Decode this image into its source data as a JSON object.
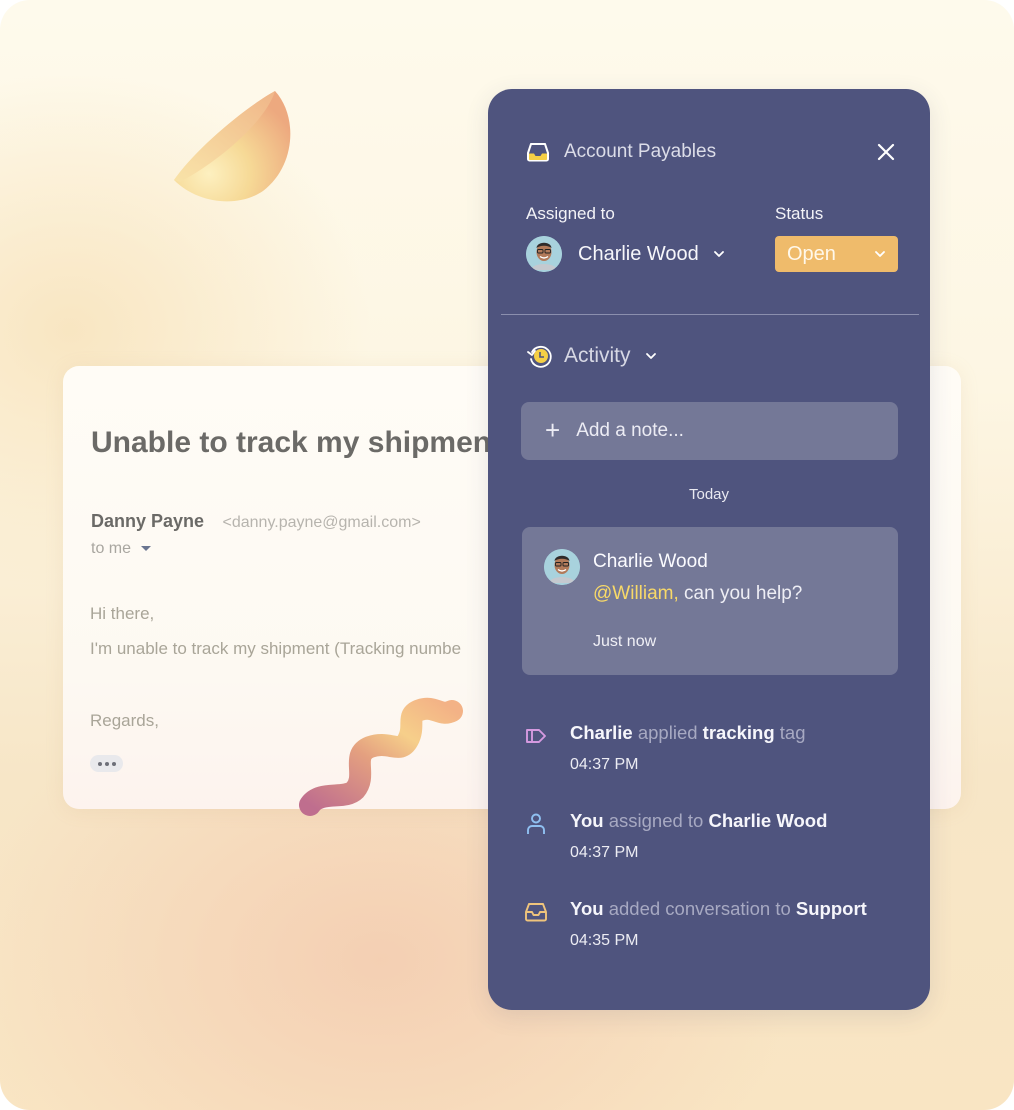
{
  "email": {
    "subject": "Unable to track my shipment",
    "sender_name": "Danny Payne",
    "sender_email": "<danny.payne@gmail.com>",
    "recipient": "to me",
    "body": [
      "Hi there,",
      "I'm unable to track my shipment (Tracking numbe"
    ],
    "signoff": "Regards,",
    "more_icon": "ellipsis-icon"
  },
  "panel": {
    "title": "Account Payables",
    "title_icon": "inbox-icon",
    "close_icon": "close-icon",
    "assigned_label": "Assigned to",
    "assignee": "Charlie Wood",
    "status_label": "Status",
    "status_value": "Open",
    "colors": {
      "panel_bg": "#4f547e",
      "status_bg": "#efbb6b",
      "mention": "#f8d968",
      "card_bg": "#747897"
    },
    "activity_label": "Activity",
    "note_placeholder": "Add a note...",
    "date_divider": "Today",
    "note": {
      "author": "Charlie Wood",
      "mention": "@William,",
      "text": " can you help?",
      "time": "Just now"
    },
    "events": [
      {
        "icon": "tag-icon",
        "actor": "Charlie",
        "verb": "applied",
        "object": "tracking",
        "suffix": "tag",
        "time": "04:37 PM"
      },
      {
        "icon": "user-icon",
        "actor": "You",
        "verb": "assigned to",
        "object": "Charlie Wood",
        "suffix": "",
        "time": "04:37 PM"
      },
      {
        "icon": "inbox-icon",
        "actor": "You",
        "verb": "added conversation to",
        "object": "Support",
        "suffix": "",
        "time": "04:35 PM"
      }
    ]
  }
}
